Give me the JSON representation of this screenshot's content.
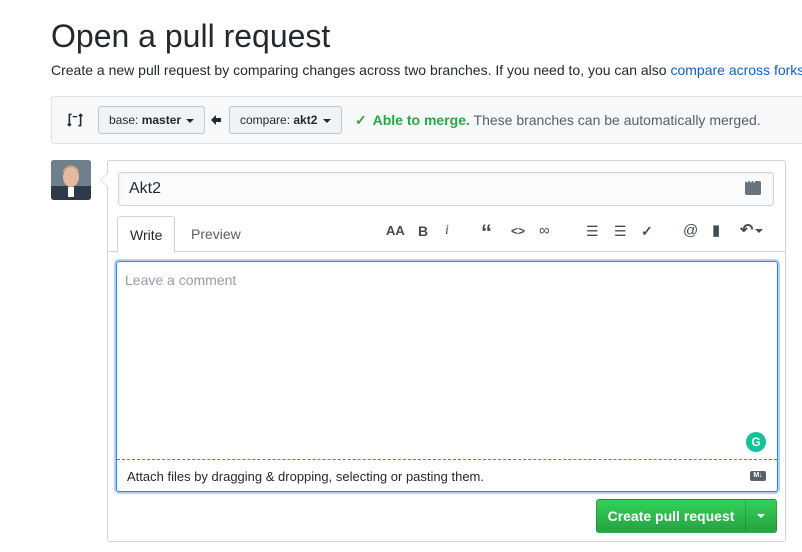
{
  "header": {
    "title": "Open a pull request",
    "subtitle": "Create a new pull request by comparing changes across two branches. If you need to, you can also ",
    "subtitle_link": "compare across forks",
    "subtitle_end": "."
  },
  "range": {
    "base_label": "base:",
    "base_branch": "master",
    "compare_label": "compare:",
    "compare_branch": "akt2",
    "merge_ok": "Able to merge.",
    "merge_text": "These branches can be automatically merged."
  },
  "form": {
    "title_value": "Akt2",
    "tabs": [
      {
        "label": "Write"
      },
      {
        "label": "Preview"
      }
    ],
    "toolbar": [
      {
        "icon": "text-size-icon",
        "glyph": "AA"
      },
      {
        "icon": "bold-icon",
        "glyph": "B"
      },
      {
        "icon": "italic-icon",
        "glyph": "i"
      },
      {
        "icon": "quote-icon",
        "glyph": "“"
      },
      {
        "icon": "code-icon",
        "glyph": "<>"
      },
      {
        "icon": "link-icon",
        "glyph": "∞"
      },
      {
        "icon": "unordered-list-icon",
        "glyph": "☰"
      },
      {
        "icon": "ordered-list-icon",
        "glyph": "☰"
      },
      {
        "icon": "task-list-icon",
        "glyph": "✓"
      },
      {
        "icon": "mention-icon",
        "glyph": "@"
      },
      {
        "icon": "bookmark-icon",
        "glyph": "▮"
      },
      {
        "icon": "reply-icon",
        "glyph": "↶"
      }
    ],
    "comment_placeholder": "Leave a comment",
    "attach_text": "Attach files by dragging & dropping, selecting or pasting them.",
    "markdown_badge": "M↓",
    "grammarly_glyph": "G",
    "submit_label": "Create pull request"
  },
  "colors": {
    "link": "#0366d6",
    "success": "#28a745",
    "focus": "#2188ff"
  }
}
